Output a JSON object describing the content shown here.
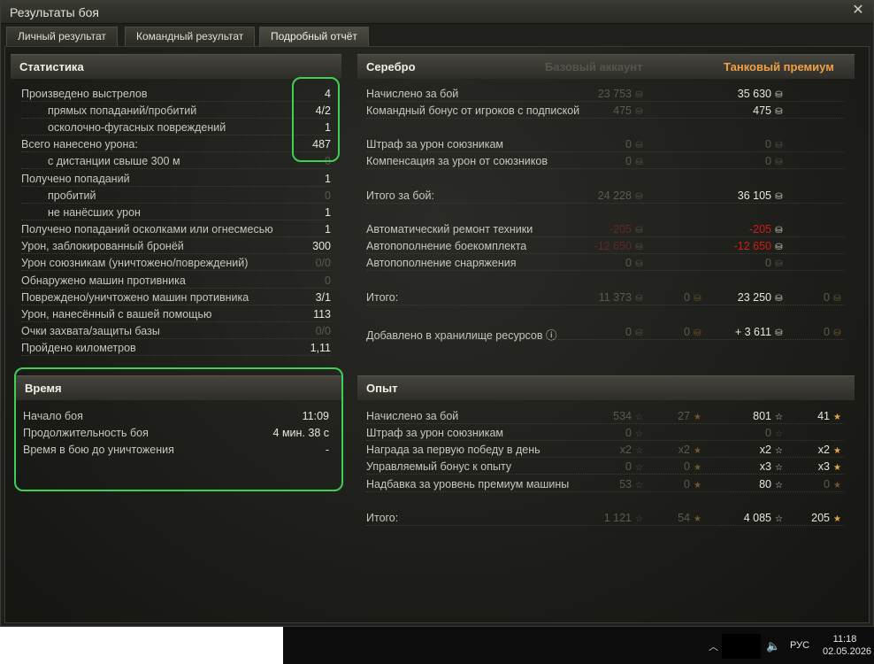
{
  "window": {
    "title": "Результаты боя",
    "close": "✕"
  },
  "tabs": [
    "Личный результат",
    "Командный результат",
    "Подробный отчёт"
  ],
  "stats": {
    "title": "Статистика",
    "rows": [
      {
        "label": "Произведено выстрелов",
        "value": "4"
      },
      {
        "label": "прямых попаданий/пробитий",
        "value": "4/2"
      },
      {
        "label": "осколочно-фугасных повреждений",
        "value": "1"
      },
      {
        "label": "Всего нанесено урона:",
        "value": "487"
      },
      {
        "label": "с дистанции свыше 300 м",
        "value": "0"
      },
      {
        "label": "Получено попаданий",
        "value": "1"
      },
      {
        "label": "пробитий",
        "value": "0"
      },
      {
        "label": "не нанёсших урон",
        "value": "1"
      },
      {
        "label": "Получено попаданий осколками или огнесмесью",
        "value": "1"
      },
      {
        "label": "Урон, заблокированный бронёй",
        "value": "300"
      },
      {
        "label": "Урон союзникам (уничтожено/повреждений)",
        "value": "0/0"
      },
      {
        "label": "Обнаружено машин противника",
        "value": "0"
      },
      {
        "label": "Повреждено/уничтожено машин противника",
        "value": "3/1"
      },
      {
        "label": "Урон, нанесённый с вашей помощью",
        "value": "113"
      },
      {
        "label": "Очки захвата/защиты базы",
        "value": "0/0"
      },
      {
        "label": "Пройдено километров",
        "value": "1,11"
      }
    ]
  },
  "time": {
    "title": "Время",
    "rows": [
      {
        "label": "Начало боя",
        "value": "11:09"
      },
      {
        "label": "Продолжительность боя",
        "value": "4 мин. 38 с"
      },
      {
        "label": "Время в бою до уничтожения",
        "value": "-"
      }
    ]
  },
  "silver": {
    "title": "Серебро",
    "col_base": "Базовый аккаунт",
    "col_premium": "Танковый премиум",
    "rows": [
      {
        "label": "Начислено за бой",
        "base": "23 753",
        "prem": "35 630"
      },
      {
        "label": "Командный бонус от игроков с подпиской",
        "base": "475",
        "prem": "475"
      },
      {
        "label": "Штраф за урон союзникам",
        "base": "0",
        "prem": "0"
      },
      {
        "label": "Компенсация за урон от союзников",
        "base": "0",
        "prem": "0"
      },
      {
        "label": "Итого за бой:",
        "base": "24 228",
        "prem": "36 105"
      },
      {
        "label": "Автоматический ремонт техники",
        "base": "-205",
        "prem": "-205"
      },
      {
        "label": "Автопополнение боекомплекта",
        "base": "-12 650",
        "prem": "-12 650"
      },
      {
        "label": "Автопополнение снаряжения",
        "base": "0",
        "prem": "0"
      },
      {
        "label": "Итого:",
        "base": "11 373",
        "base_gold": "0",
        "prem": "23 250",
        "prem_gold": "0"
      },
      {
        "label": "Добавлено в хранилище ресурсов",
        "base": "0",
        "base_gold": "0",
        "prem": "+ 3 611",
        "prem_gold": "0"
      }
    ]
  },
  "xp": {
    "title": "Опыт",
    "rows": [
      {
        "label": "Начислено за бой",
        "base": "534",
        "base_free": "27",
        "prem": "801",
        "prem_free": "41"
      },
      {
        "label": "Штраф за урон союзникам",
        "base": "0",
        "prem": "0"
      },
      {
        "label": "Награда за первую победу в день",
        "base": "x2",
        "base_free": "x2",
        "prem": "x2",
        "prem_free": "x2"
      },
      {
        "label": "Управляемый бонус к опыту",
        "base": "0",
        "base_free": "0",
        "prem": "x3",
        "prem_free": "x3"
      },
      {
        "label": "Надбавка за уровень премиум машины",
        "base": "53",
        "base_free": "0",
        "prem": "80",
        "prem_free": "0"
      },
      {
        "label": "Итого:",
        "base": "1 121",
        "base_free": "54",
        "prem": "4 085",
        "prem_free": "205"
      }
    ]
  },
  "icons": {
    "credits": "credits-icon",
    "gold": "gold-icon",
    "xp": "xp-star-icon",
    "free_xp": "free-xp-star-icon",
    "info": "info-icon",
    "speaker": "speaker-icon"
  },
  "colors": {
    "premium": "#f0a045",
    "negative": "#d21d12",
    "highlight": "#3fcf55"
  },
  "taskbar": {
    "lang": "РУС",
    "time": "11:18",
    "date": "02.05.2026"
  }
}
